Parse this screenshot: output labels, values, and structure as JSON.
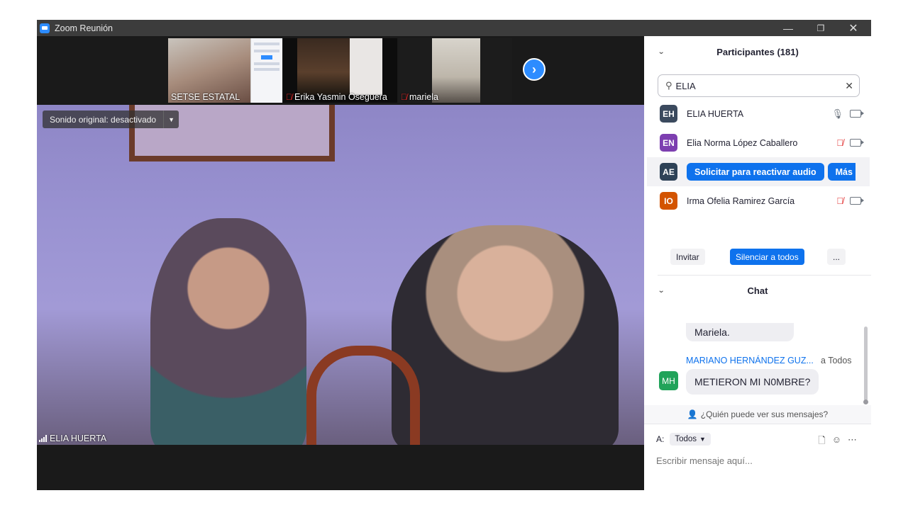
{
  "window": {
    "title": "Zoom Reunión",
    "minimize_glyph": "—",
    "restore_glyph": "❐",
    "close_glyph": "✕"
  },
  "thumbnails": [
    {
      "name": "SETSE ESTATAL",
      "muted": false
    },
    {
      "name": "Erika Yasmin Oseguera",
      "muted": true
    },
    {
      "name": "mariela",
      "muted": true
    }
  ],
  "main_video": {
    "sound_label": "Sonido original: desactivado",
    "speaker_name": "ELIA HUERTA"
  },
  "participants": {
    "header": "Participantes (181)",
    "search_value": "ELIA",
    "list": [
      {
        "initials": "EH",
        "name": "ELIA HUERTA",
        "color": "#3b4a5e",
        "mic": "on"
      },
      {
        "initials": "EN",
        "name": "Elia Norma López Caballero",
        "color": "#7d3fb0",
        "mic": "muted"
      },
      {
        "initials": "AE",
        "name": "",
        "color": "#2e4257",
        "mic": "hover"
      },
      {
        "initials": "IO",
        "name": "Irma Ofelia Ramirez García",
        "color": "#d35400",
        "mic": "muted"
      }
    ],
    "ask_unmute_label": "Solicitar para reactivar audio",
    "more_label": "Más",
    "invite_label": "Invitar",
    "mute_all_label": "Silenciar a todos",
    "more_options_label": "..."
  },
  "chat": {
    "header": "Chat",
    "prev_message": "Mariela.",
    "sender_name": "MARIANO HERNÁNDEZ GUZ...",
    "sender_initials": "MH",
    "sender_color": "#21a35a",
    "recipient": "a Todos",
    "message": "METIERON MI N0MBRE?",
    "who_sees": "¿Quién puede ver sus mensajes?",
    "to_label": "A:",
    "to_value": "Todos",
    "placeholder": "Escribir mensaje aquí..."
  }
}
